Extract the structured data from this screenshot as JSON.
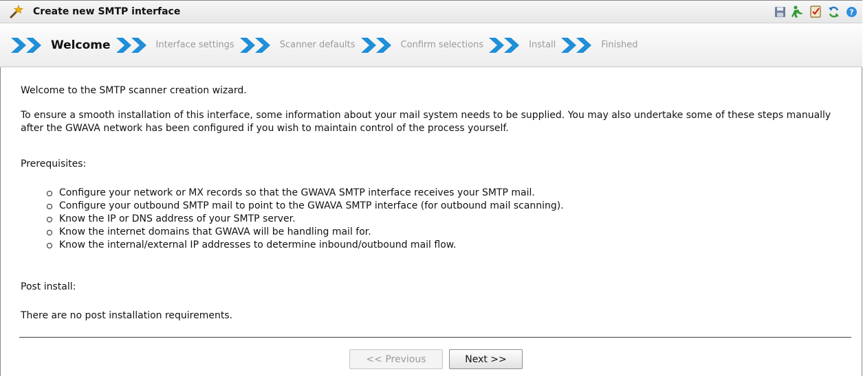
{
  "window": {
    "title": "Create new SMTP interface"
  },
  "toolbar": {
    "icons": [
      "save-icon",
      "run-icon",
      "checklist-icon",
      "refresh-icon",
      "help-icon"
    ]
  },
  "steps": [
    {
      "label": "Welcome",
      "active": true
    },
    {
      "label": "Interface settings",
      "active": false
    },
    {
      "label": "Scanner defaults",
      "active": false
    },
    {
      "label": "Confirm selections",
      "active": false
    },
    {
      "label": "Install",
      "active": false
    },
    {
      "label": "Finished",
      "active": false
    }
  ],
  "content": {
    "intro": "Welcome to the SMTP scanner creation wizard.",
    "description": "To ensure a smooth installation of this interface, some information about your mail system needs to be supplied. You may also undertake some of these steps manually after the GWAVA network has been configured if you wish to maintain control of the process yourself.",
    "prerequisites_heading": "Prerequisites:",
    "prerequisites": [
      "Configure your network or MX records so that the GWAVA SMTP interface receives your SMTP mail.",
      "Configure your outbound SMTP mail to point to the GWAVA SMTP interface (for outbound mail scanning).",
      "Know the IP or DNS address of your SMTP server.",
      "Know the internet domains that GWAVA will be handling mail for.",
      "Know the internal/external IP addresses to determine inbound/outbound mail flow."
    ],
    "post_install_heading": "Post install:",
    "post_install_text": "There are no post installation requirements."
  },
  "buttons": {
    "previous": {
      "label": "<< Previous",
      "enabled": false
    },
    "next": {
      "label": "Next >>",
      "enabled": true
    }
  },
  "colors": {
    "step_arrow": "#1e8fd8",
    "inactive_step": "#9a9a9a"
  }
}
